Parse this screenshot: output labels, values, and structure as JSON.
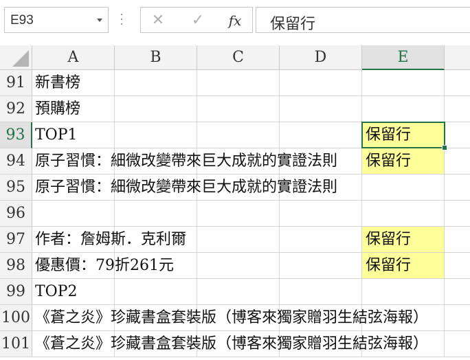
{
  "formula_bar": {
    "name_box": "E93",
    "cancel_symbol": "✕",
    "enter_symbol": "✓",
    "fx_label": "fx",
    "formula": "保留行"
  },
  "columns": [
    "A",
    "B",
    "C",
    "D",
    "E"
  ],
  "selected_column": "E",
  "selected_row": "93",
  "active_cell": "E93",
  "colors": {
    "highlight": "#ffff99",
    "accent": "#217346"
  },
  "rows": [
    {
      "num": "91",
      "a": "新書榜",
      "e": ""
    },
    {
      "num": "92",
      "a": "預購榜",
      "e": ""
    },
    {
      "num": "93",
      "a": "TOP1",
      "e": "保留行"
    },
    {
      "num": "94",
      "a": "原子習慣：細微改變帶來巨大成就的實證法則",
      "e": "保留行"
    },
    {
      "num": "95",
      "a": "原子習慣：細微改變帶來巨大成就的實證法則",
      "e": ""
    },
    {
      "num": "96",
      "a": "",
      "e": ""
    },
    {
      "num": "97",
      "a": "作者：詹姆斯．克利爾",
      "e": "保留行"
    },
    {
      "num": "98",
      "a": "優惠價：79折261元",
      "e": "保留行"
    },
    {
      "num": "99",
      "a": "TOP2",
      "e": ""
    },
    {
      "num": "100",
      "a": "《蒼之炎》珍藏書盒套裝版（博客來獨家贈羽生結弦海報）",
      "e": ""
    },
    {
      "num": "101",
      "a": "《蒼之炎》珍藏書盒套裝版（博客來獨家贈羽生結弦海報）",
      "e": ""
    }
  ]
}
